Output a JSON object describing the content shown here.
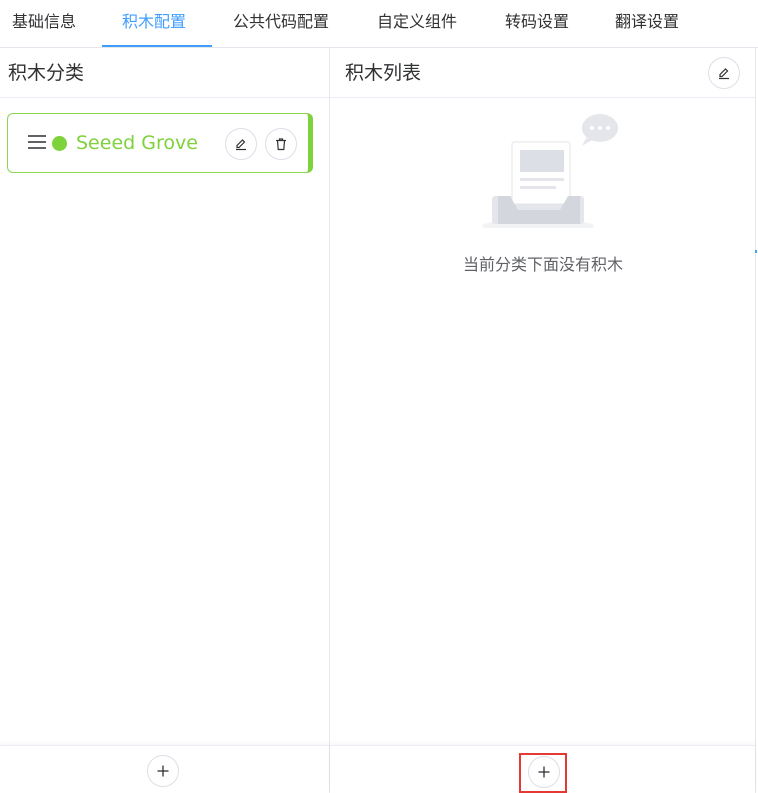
{
  "tabs": [
    {
      "label": "基础信息",
      "active": false
    },
    {
      "label": "积木配置",
      "active": true
    },
    {
      "label": "公共代码配置",
      "active": false
    },
    {
      "label": "自定义组件",
      "active": false
    },
    {
      "label": "转码设置",
      "active": false
    },
    {
      "label": "翻译设置",
      "active": false
    }
  ],
  "left_panel": {
    "title": "积木分类",
    "categories": [
      {
        "name": "Seeed Grove",
        "color": "#7ed23b"
      }
    ],
    "add_icon": "plus-icon"
  },
  "right_panel": {
    "title": "积木列表",
    "edit_icon": "edit-icon",
    "empty_text": "当前分类下面没有积木",
    "add_icon": "plus-icon"
  },
  "colors": {
    "accent": "#409eff",
    "category_green": "#7ed23b",
    "highlight_red": "#e53935"
  }
}
